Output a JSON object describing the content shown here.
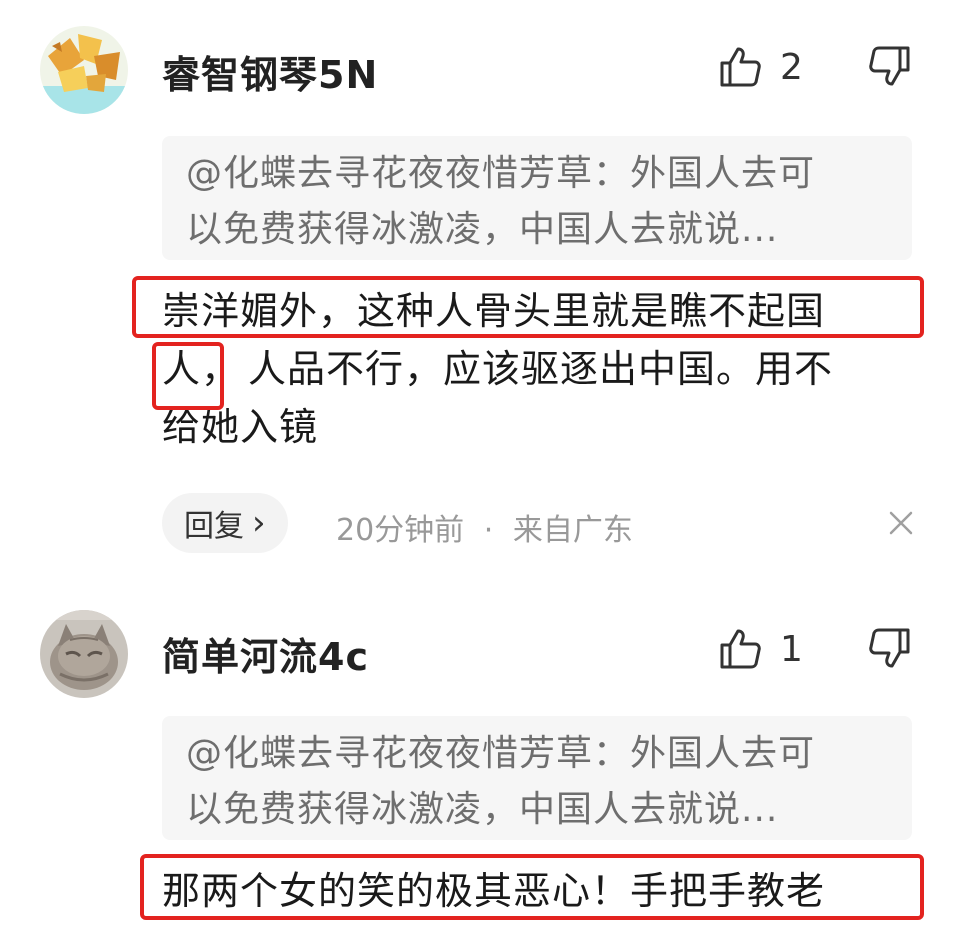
{
  "comments": [
    {
      "username": "睿智钢琴5N",
      "like_count": "2",
      "quote_line1": "@化蝶去寻花夜夜惜芳草：外国人去可",
      "quote_line2": "以免费获得冰激凌，中国人去就说...",
      "text_line1": "崇洋媚外，这种人骨头里就是瞧不起国",
      "text_line2_word": "人，",
      "text_line2_rest": "人品不行，应该驱逐出中国。用不",
      "text_line3": "给她入镜",
      "reply_label": "回复",
      "reply_chevron": "›",
      "time": "20分钟前",
      "separator": "·",
      "location": "来自广东",
      "avatar_icon": "gold-leaf-avatar-icon"
    },
    {
      "username": "简单河流4c",
      "like_count": "1",
      "quote_line1": "@化蝶去寻花夜夜惜芳草：外国人去可",
      "quote_line2": "以免费获得冰激凌，中国人去就说...",
      "text_line1": "那两个女的笑的极其恶心！手把手教老",
      "avatar_icon": "cat-photo-avatar-icon"
    }
  ],
  "icons": {
    "like": "thumbs-up-icon",
    "dislike": "thumbs-down-icon",
    "close": "close-icon"
  },
  "colors": {
    "highlight": "#e3231f",
    "quote_bg": "#f6f6f6",
    "meta_text": "#999999"
  }
}
